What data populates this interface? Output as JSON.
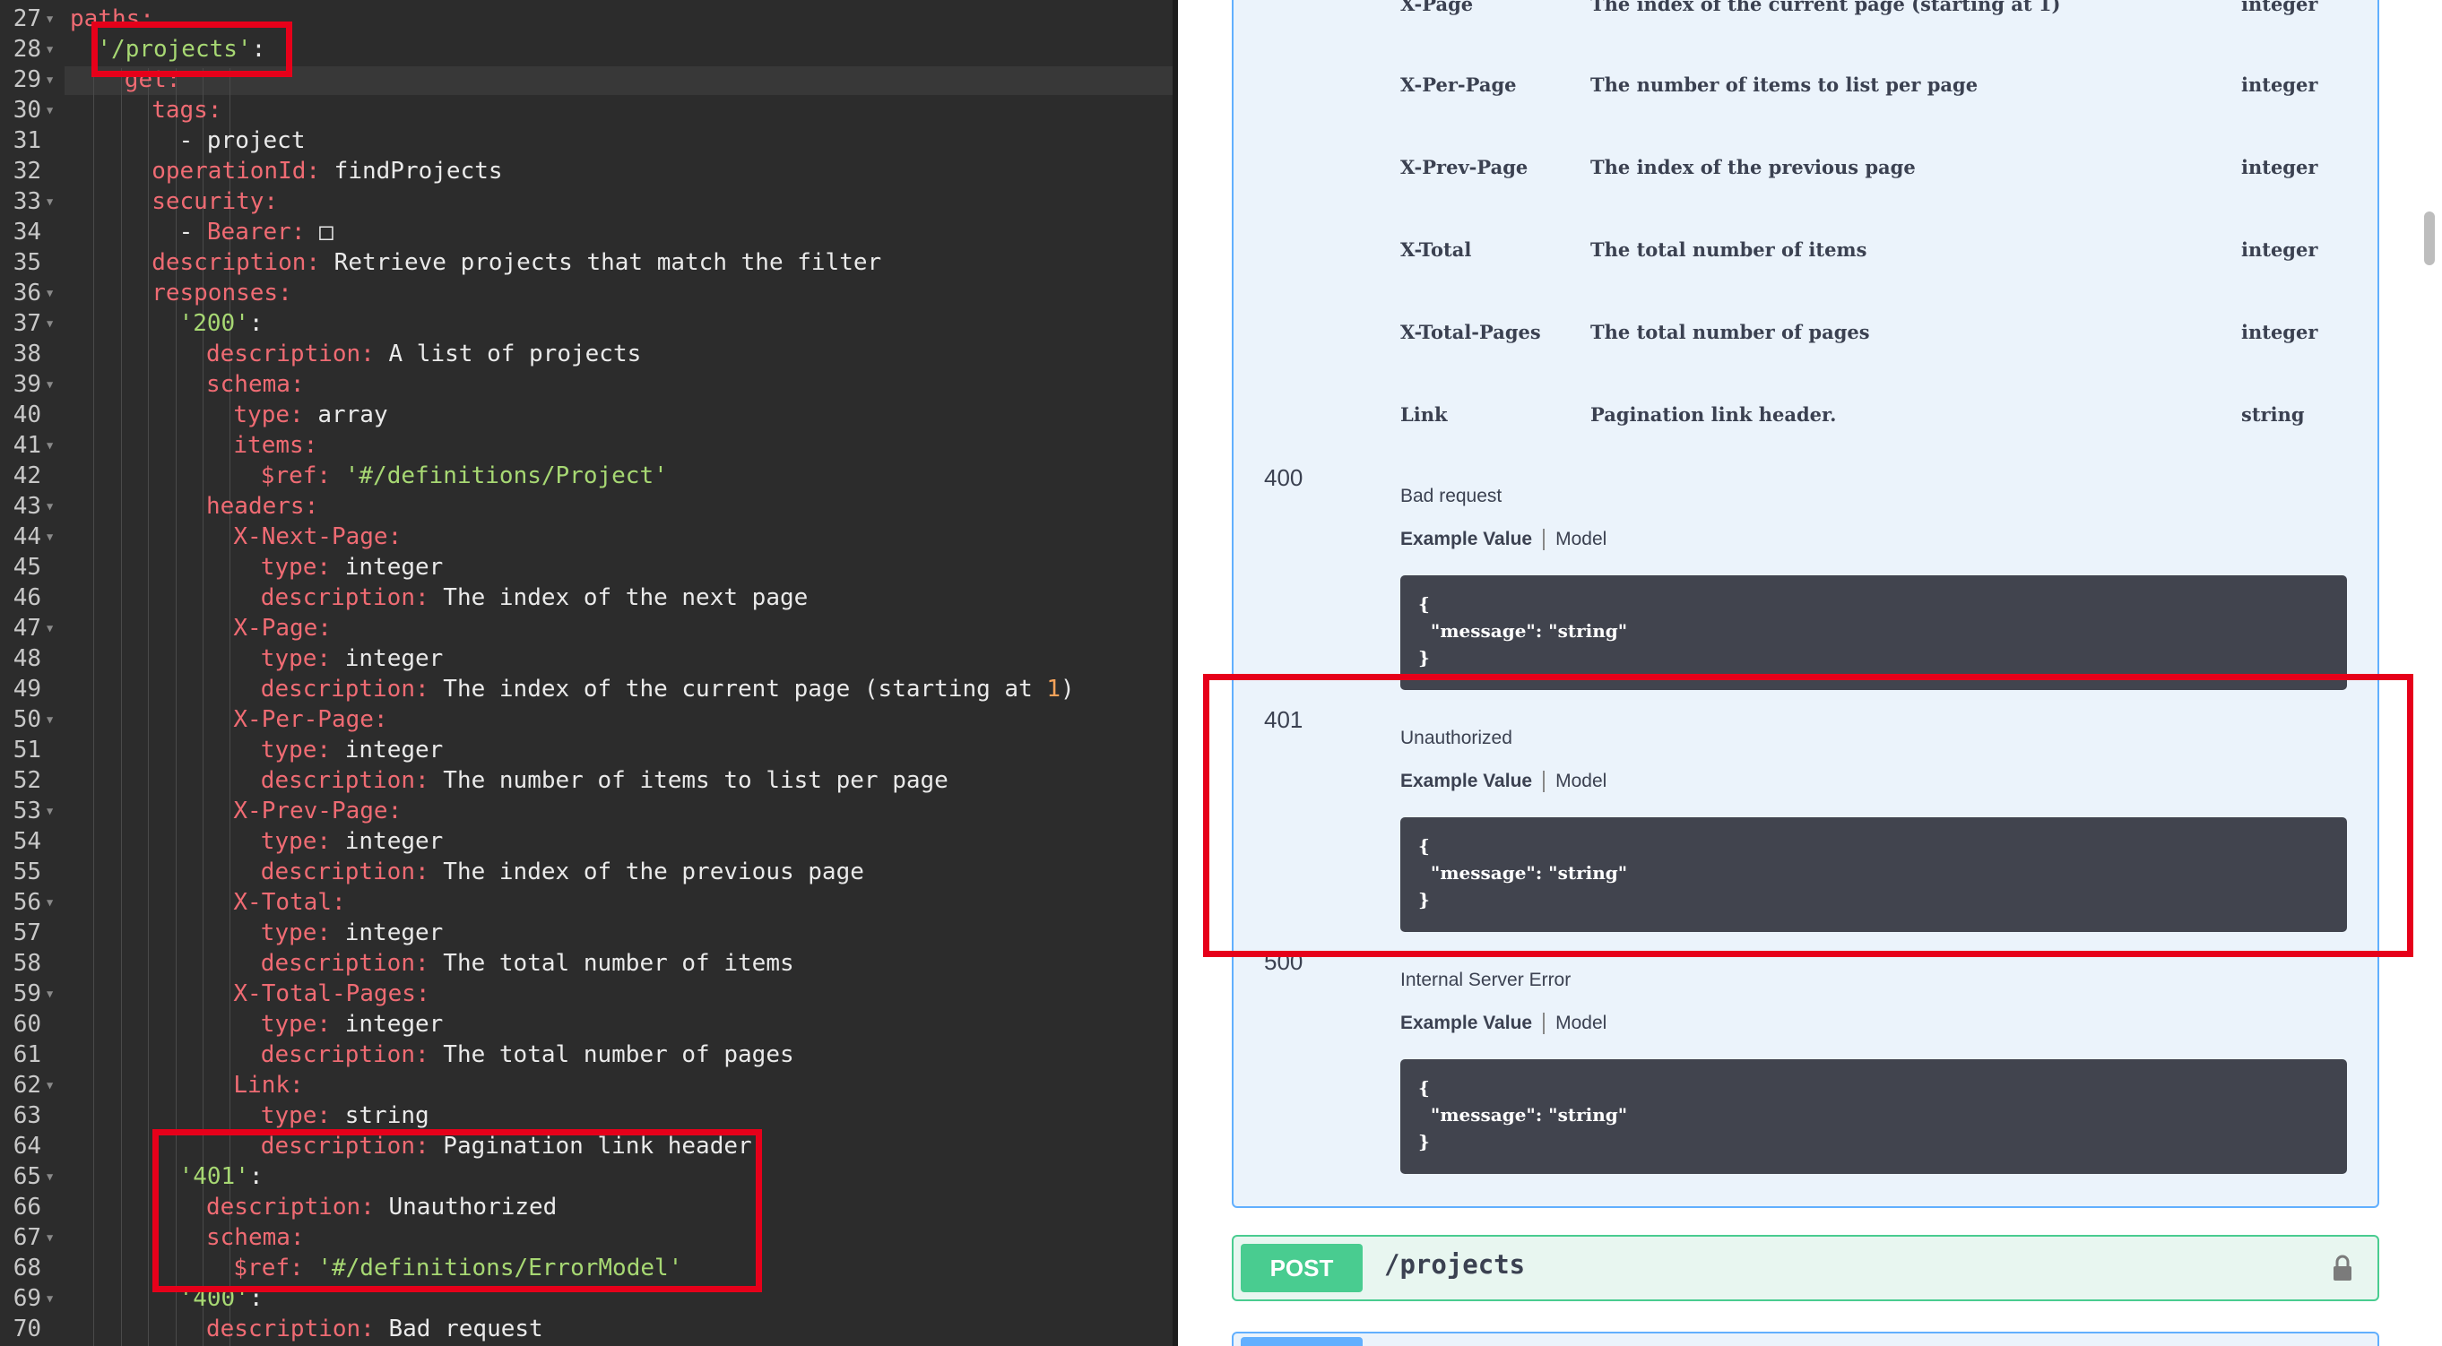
{
  "editor": {
    "lines": [
      {
        "n": "27",
        "i": 0,
        "t": [
          [
            "k",
            "paths:"
          ]
        ]
      },
      {
        "n": "28",
        "i": 1,
        "t": [
          [
            "s",
            "'/projects'"
          ],
          [
            "v",
            ":"
          ]
        ]
      },
      {
        "n": "29",
        "i": 2,
        "t": [
          [
            "k",
            "get:"
          ]
        ]
      },
      {
        "n": "30",
        "i": 3,
        "t": [
          [
            "k",
            "tags:"
          ]
        ]
      },
      {
        "n": "31",
        "i": 4,
        "t": [
          [
            "v",
            "- project"
          ]
        ]
      },
      {
        "n": "32",
        "i": 3,
        "t": [
          [
            "k",
            "operationId:"
          ],
          [
            "v",
            " findProjects"
          ]
        ]
      },
      {
        "n": "33",
        "i": 3,
        "t": [
          [
            "k",
            "security:"
          ]
        ]
      },
      {
        "n": "34",
        "i": 4,
        "t": [
          [
            "v",
            "- "
          ],
          [
            "k",
            "Bearer:"
          ],
          [
            "v",
            " □"
          ]
        ]
      },
      {
        "n": "35",
        "i": 3,
        "t": [
          [
            "k",
            "description:"
          ],
          [
            "v",
            " Retrieve projects that match the filter"
          ]
        ]
      },
      {
        "n": "36",
        "i": 3,
        "t": [
          [
            "k",
            "responses:"
          ]
        ]
      },
      {
        "n": "37",
        "i": 4,
        "t": [
          [
            "s",
            "'200'"
          ],
          [
            "v",
            ":"
          ]
        ]
      },
      {
        "n": "38",
        "i": 5,
        "t": [
          [
            "k",
            "description:"
          ],
          [
            "v",
            " A list of projects"
          ]
        ]
      },
      {
        "n": "39",
        "i": 5,
        "t": [
          [
            "k",
            "schema:"
          ]
        ]
      },
      {
        "n": "40",
        "i": 6,
        "t": [
          [
            "k",
            "type:"
          ],
          [
            "v",
            " array"
          ]
        ]
      },
      {
        "n": "41",
        "i": 6,
        "t": [
          [
            "k",
            "items:"
          ]
        ]
      },
      {
        "n": "42",
        "i": 7,
        "t": [
          [
            "k",
            "$ref:"
          ],
          [
            "s",
            " '#/definitions/Project'"
          ]
        ]
      },
      {
        "n": "43",
        "i": 5,
        "t": [
          [
            "k",
            "headers:"
          ]
        ]
      },
      {
        "n": "44",
        "i": 6,
        "t": [
          [
            "k",
            "X-Next-Page:"
          ]
        ]
      },
      {
        "n": "45",
        "i": 7,
        "t": [
          [
            "k",
            "type:"
          ],
          [
            "v",
            " integer"
          ]
        ]
      },
      {
        "n": "46",
        "i": 7,
        "t": [
          [
            "k",
            "description:"
          ],
          [
            "v",
            " The index of the next page"
          ]
        ]
      },
      {
        "n": "47",
        "i": 6,
        "t": [
          [
            "k",
            "X-Page:"
          ]
        ]
      },
      {
        "n": "48",
        "i": 7,
        "t": [
          [
            "k",
            "type:"
          ],
          [
            "v",
            " integer"
          ]
        ]
      },
      {
        "n": "49",
        "i": 7,
        "t": [
          [
            "k",
            "description:"
          ],
          [
            "v",
            " The index of the current page (starting at "
          ],
          [
            "n",
            "1"
          ],
          [
            "v",
            ")"
          ]
        ]
      },
      {
        "n": "50",
        "i": 6,
        "t": [
          [
            "k",
            "X-Per-Page:"
          ]
        ]
      },
      {
        "n": "51",
        "i": 7,
        "t": [
          [
            "k",
            "type:"
          ],
          [
            "v",
            " integer"
          ]
        ]
      },
      {
        "n": "52",
        "i": 7,
        "t": [
          [
            "k",
            "description:"
          ],
          [
            "v",
            " The number of items to list per page"
          ]
        ]
      },
      {
        "n": "53",
        "i": 6,
        "t": [
          [
            "k",
            "X-Prev-Page:"
          ]
        ]
      },
      {
        "n": "54",
        "i": 7,
        "t": [
          [
            "k",
            "type:"
          ],
          [
            "v",
            " integer"
          ]
        ]
      },
      {
        "n": "55",
        "i": 7,
        "t": [
          [
            "k",
            "description:"
          ],
          [
            "v",
            " The index of the previous page"
          ]
        ]
      },
      {
        "n": "56",
        "i": 6,
        "t": [
          [
            "k",
            "X-Total:"
          ]
        ]
      },
      {
        "n": "57",
        "i": 7,
        "t": [
          [
            "k",
            "type:"
          ],
          [
            "v",
            " integer"
          ]
        ]
      },
      {
        "n": "58",
        "i": 7,
        "t": [
          [
            "k",
            "description:"
          ],
          [
            "v",
            " The total number of items"
          ]
        ]
      },
      {
        "n": "59",
        "i": 6,
        "t": [
          [
            "k",
            "X-Total-Pages:"
          ]
        ]
      },
      {
        "n": "60",
        "i": 7,
        "t": [
          [
            "k",
            "type:"
          ],
          [
            "v",
            " integer"
          ]
        ]
      },
      {
        "n": "61",
        "i": 7,
        "t": [
          [
            "k",
            "description:"
          ],
          [
            "v",
            " The total number of pages"
          ]
        ]
      },
      {
        "n": "62",
        "i": 6,
        "t": [
          [
            "k",
            "Link:"
          ]
        ]
      },
      {
        "n": "63",
        "i": 7,
        "t": [
          [
            "k",
            "type:"
          ],
          [
            "v",
            " string"
          ]
        ]
      },
      {
        "n": "64",
        "i": 7,
        "t": [
          [
            "k",
            "description:"
          ],
          [
            "v",
            " Pagination link header."
          ]
        ]
      },
      {
        "n": "65",
        "i": 4,
        "t": [
          [
            "s",
            "'401'"
          ],
          [
            "v",
            ":"
          ]
        ]
      },
      {
        "n": "66",
        "i": 5,
        "t": [
          [
            "k",
            "description:"
          ],
          [
            "v",
            " Unauthorized"
          ]
        ]
      },
      {
        "n": "67",
        "i": 5,
        "t": [
          [
            "k",
            "schema:"
          ]
        ]
      },
      {
        "n": "68",
        "i": 6,
        "t": [
          [
            "k",
            "$ref:"
          ],
          [
            "s",
            " '#/definitions/ErrorModel'"
          ]
        ]
      },
      {
        "n": "69",
        "i": 4,
        "t": [
          [
            "s",
            "'400'"
          ],
          [
            "v",
            ":"
          ]
        ]
      },
      {
        "n": "70",
        "i": 5,
        "t": [
          [
            "k",
            "description:"
          ],
          [
            "v",
            " Bad request"
          ]
        ]
      }
    ]
  },
  "docs": {
    "headers": [
      {
        "name": "X-Page",
        "desc": "The index of the current page (starting at 1)",
        "type": "integer"
      },
      {
        "name": "X-Per-Page",
        "desc": "The number of items to list per page",
        "type": "integer"
      },
      {
        "name": "X-Prev-Page",
        "desc": "The index of the previous page",
        "type": "integer"
      },
      {
        "name": "X-Total",
        "desc": "The total number of items",
        "type": "integer"
      },
      {
        "name": "X-Total-Pages",
        "desc": "The total number of pages",
        "type": "integer"
      },
      {
        "name": "Link",
        "desc": "Pagination link header.",
        "type": "string"
      }
    ],
    "responses": [
      {
        "code": "400",
        "desc": "Bad request",
        "tab_example": "Example Value",
        "tab_model": "Model",
        "example": [
          "{",
          "  \"message\": \"string\"",
          "}"
        ]
      },
      {
        "code": "401",
        "desc": "Unauthorized",
        "tab_example": "Example Value",
        "tab_model": "Model",
        "example": [
          "{",
          "  \"message\": \"string\"",
          "}"
        ]
      },
      {
        "code": "500",
        "desc": "Internal Server Error",
        "tab_example": "Example Value",
        "tab_model": "Model",
        "example": [
          "{",
          "  \"message\": \"string\"",
          "}"
        ]
      }
    ],
    "post": {
      "method": "POST",
      "path": "/projects"
    }
  }
}
